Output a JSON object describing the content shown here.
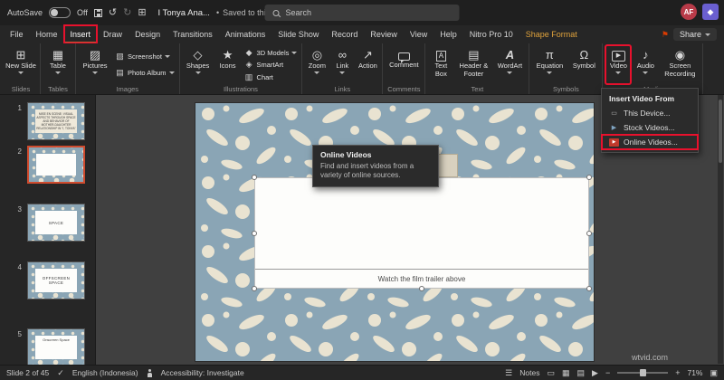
{
  "titlebar": {
    "autosave_label": "AutoSave",
    "autosave_state": "Off",
    "doc_title": "I Tonya Ana...",
    "saved_separator": "•",
    "saved_status": "Saved to this PC",
    "search_placeholder": "Search",
    "avatar_initials": "AF"
  },
  "ribbon": {
    "tabs": [
      {
        "label": "File"
      },
      {
        "label": "Home"
      },
      {
        "label": "Insert"
      },
      {
        "label": "Draw"
      },
      {
        "label": "Design"
      },
      {
        "label": "Transitions"
      },
      {
        "label": "Animations"
      },
      {
        "label": "Slide Show"
      },
      {
        "label": "Record"
      },
      {
        "label": "Review"
      },
      {
        "label": "View"
      },
      {
        "label": "Help"
      },
      {
        "label": "Nitro Pro 10"
      },
      {
        "label": "Shape Format"
      }
    ],
    "share_label": "Share",
    "groups": [
      {
        "label": "Slides"
      },
      {
        "label": "Tables"
      },
      {
        "label": "Images"
      },
      {
        "label": "Illustrations"
      },
      {
        "label": "Links"
      },
      {
        "label": "Comments"
      },
      {
        "label": "Text"
      },
      {
        "label": "Symbols"
      },
      {
        "label": "Media"
      }
    ],
    "buttons": {
      "new_slide": "New Slide",
      "table": "Table",
      "pictures": "Pictures",
      "screenshot": "Screenshot",
      "photo_album": "Photo Album",
      "shapes": "Shapes",
      "icons": "Icons",
      "models_3d": "3D Models",
      "smartart": "SmartArt",
      "chart": "Chart",
      "zoom": "Zoom",
      "link": "Link",
      "action": "Action",
      "comment": "Comment",
      "text_box": "Text Box",
      "header_footer": "Header & Footer",
      "wordart": "WordArt",
      "equation": "Equation",
      "symbol": "Symbol",
      "video": "Video",
      "audio": "Audio",
      "screen_recording": "Screen Recording"
    }
  },
  "video_menu": {
    "header": "Insert Video From",
    "items": [
      {
        "label": "This Device..."
      },
      {
        "label": "Stock Videos..."
      },
      {
        "label": "Online Videos..."
      }
    ]
  },
  "tooltip": {
    "title": "Online Videos",
    "body": "Find and insert videos from a variety of online sources."
  },
  "thumbnails": [
    {
      "number": "1",
      "text": "MISE EN SCENE: VISUAL ASPECTS THROUGH SPACE AND BEHAVIOR OF MOTHER-DAUGHTER RELATIONSHIP IN \"I, TONYA\""
    },
    {
      "number": "2",
      "text": ""
    },
    {
      "number": "3",
      "text": "SPACE"
    },
    {
      "number": "4",
      "text": "OFFSCREEN SPACE"
    },
    {
      "number": "5",
      "text": "Onscreen Space"
    }
  ],
  "slide": {
    "caption": "Watch the film trailer above"
  },
  "statusbar": {
    "slide_indicator": "Slide 2 of 45",
    "language": "English (Indonesia)",
    "accessibility": "Accessibility: Investigate",
    "notes_label": "Notes",
    "zoom_percent": "71%"
  },
  "watermark": "wtvid.com"
}
